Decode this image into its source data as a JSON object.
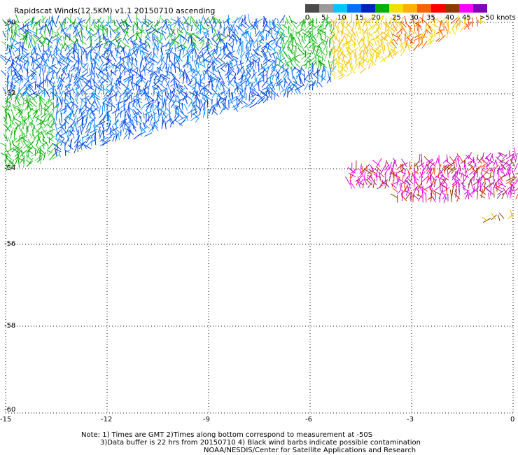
{
  "title": "Rapidscat Winds(12.5KM) v1.1 20150710 ascending",
  "colorbar": {
    "labels": [
      "0",
      "5",
      "10",
      "15",
      "20",
      "25",
      "30",
      "35",
      "40",
      "45",
      ">50 knots"
    ],
    "colors": [
      "#4a4a4a",
      "#9a9a9a",
      "#00c8ff",
      "#0070ff",
      "#0020c0",
      "#00b000",
      "#f0e000",
      "#ffb000",
      "#ff6000",
      "#ff0000",
      "#8b3a00",
      "#ff00ff",
      "#8000c0"
    ]
  },
  "axes": {
    "x_ticks": [
      "-15",
      "-12",
      "-9",
      "-6",
      "-3",
      "0"
    ],
    "y_ticks": [
      "-50",
      "-52",
      "-54",
      "-56",
      "-58",
      "-60"
    ]
  },
  "notes": {
    "line1": "Note: 1) Times are GMT 2)Times along bottom correspond to measurement at -50S",
    "line2": "3)Data buffer is 22 hrs from 20150710 4) Black wind barbs indicate possible contamination",
    "line3": "NOAA/NESDIS/Center for Satellite Applications and Research"
  }
}
